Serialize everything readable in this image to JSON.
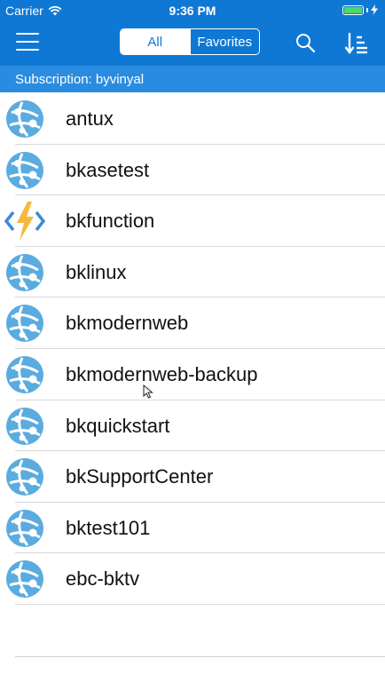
{
  "status_bar": {
    "carrier": "Carrier",
    "time": "9:36 PM",
    "battery_level": 1.0,
    "wifi_icon": "wifi-icon",
    "battery_icon": "battery-icon",
    "charging_icon": "bolt-icon"
  },
  "nav": {
    "menu_icon": "hamburger-menu-icon",
    "tabs": {
      "all": "All",
      "favorites": "Favorites",
      "active": "All"
    },
    "search_icon": "search-icon",
    "sort_icon": "sort-icon"
  },
  "subscription": {
    "label": "Subscription: byvinyal"
  },
  "items": [
    {
      "label": "antux",
      "icon": "web-app-icon"
    },
    {
      "label": "bkasetest",
      "icon": "web-app-icon"
    },
    {
      "label": "bkfunction",
      "icon": "function-app-icon"
    },
    {
      "label": "bklinux",
      "icon": "web-app-icon"
    },
    {
      "label": "bkmodernweb",
      "icon": "web-app-icon"
    },
    {
      "label": "bkmodernweb-backup",
      "icon": "web-app-icon"
    },
    {
      "label": "bkquickstart",
      "icon": "web-app-icon"
    },
    {
      "label": "bkSupportCenter",
      "icon": "web-app-icon"
    },
    {
      "label": "bktest101",
      "icon": "web-app-icon"
    },
    {
      "label": "ebc-bktv",
      "icon": "web-app-icon"
    }
  ],
  "colors": {
    "header_blue": "#0f78d4",
    "subscription_blue": "#2a8ce0",
    "web_app_icon": "#5aabdf",
    "function_bolt": "#f6b93b",
    "function_brackets": "#3b8ad6"
  }
}
